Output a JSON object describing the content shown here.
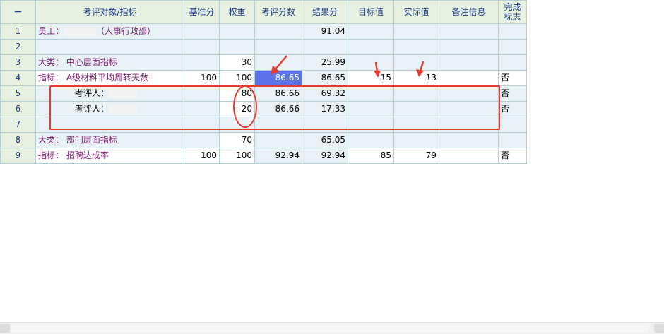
{
  "header": {
    "corner": "－",
    "columns": [
      "考评对象/指标",
      "基准分",
      "权重",
      "考评分数",
      "结果分",
      "目标值",
      "实际值",
      "备注信息",
      "完成标志"
    ]
  },
  "rows": [
    {
      "num": "1",
      "name": "员工：",
      "name_suffix": "（人事行政部）",
      "base": "",
      "weight": "",
      "score": "",
      "result": "91.04",
      "target": "",
      "actual": "",
      "note": "",
      "flag": ""
    },
    {
      "num": "2",
      "name": "",
      "base": "",
      "weight": "",
      "score": "",
      "result": "",
      "target": "",
      "actual": "",
      "note": "",
      "flag": ""
    },
    {
      "num": "3",
      "name": "大类：  中心层面指标",
      "base": "",
      "weight": "30",
      "score": "",
      "result": "25.99",
      "target": "",
      "actual": "",
      "note": "",
      "flag": ""
    },
    {
      "num": "4",
      "name": "指标：  A级材料平均周转天数",
      "base": "100",
      "weight": "100",
      "score": "86.65",
      "result": "86.65",
      "target": "15",
      "actual": "13",
      "note": "",
      "flag": "否"
    },
    {
      "num": "5",
      "name": "考评人：",
      "base": "",
      "weight": "80",
      "score": "86.66",
      "result": "69.32",
      "target": "",
      "actual": "",
      "note": "",
      "flag": "否"
    },
    {
      "num": "6",
      "name": "考评人：",
      "base": "",
      "weight": "20",
      "score": "86.66",
      "result": "17.33",
      "target": "",
      "actual": "",
      "note": "",
      "flag": "否"
    },
    {
      "num": "7",
      "name": "",
      "base": "",
      "weight": "",
      "score": "",
      "result": "",
      "target": "",
      "actual": "",
      "note": "",
      "flag": ""
    },
    {
      "num": "8",
      "name": "大类：  部门层面指标",
      "base": "",
      "weight": "70",
      "score": "",
      "result": "65.05",
      "target": "",
      "actual": "",
      "note": "",
      "flag": ""
    },
    {
      "num": "9",
      "name": "指标：  招聘达成率",
      "base": "100",
      "weight": "100",
      "score": "92.94",
      "result": "92.94",
      "target": "85",
      "actual": "79",
      "note": "",
      "flag": "否"
    }
  ],
  "colors": {
    "annotation": "#e53b2f",
    "selected": "#5b73e8",
    "header_bg": "#e6f2df",
    "cell_bg": "#e8f1f5"
  }
}
